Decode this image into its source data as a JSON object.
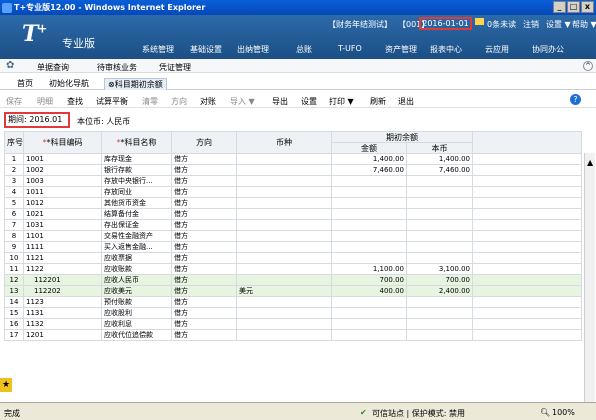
{
  "window": {
    "title": "T+专业版12.00 - Windows Internet Explorer",
    "min": "_",
    "max": "□",
    "close": "x"
  },
  "banner": {
    "logo": "T",
    "logo_plus": "+",
    "edition": "专业版",
    "company": "【财务年结测试】",
    "user": "【001】",
    "date": "2016-01-01",
    "messages": "0条未读",
    "logout": "注销",
    "settings": "设置 ▼",
    "help": "帮助 ▼"
  },
  "nav": {
    "items": [
      "系统管理",
      "基础设置",
      "出纳管理",
      "总账",
      "T-UFO",
      "资产管理",
      "报表中心",
      "云应用",
      "协同办公"
    ]
  },
  "subnav": {
    "items": [
      "单据查询",
      "待审核业务",
      "凭证管理"
    ]
  },
  "tabs": {
    "home": "首页",
    "guide": "初始化导航",
    "active": "科目期初余额"
  },
  "toolbar": {
    "items": [
      "保存",
      "明细",
      "查找",
      "试算平衡",
      "清零",
      "方向",
      "对账",
      "导入 ▼",
      "导出",
      "设置",
      "打印 ▼",
      "刷新",
      "退出"
    ],
    "help": "?"
  },
  "info": {
    "period_label": "期间:",
    "period": "2016.01",
    "currency": "本位币: 人民币"
  },
  "table": {
    "headers": {
      "seq": "序号",
      "code": "*科目编码",
      "name": "*科目名称",
      "direction": "方向",
      "currency": "币种",
      "opening": "期初余额",
      "amount": "金额",
      "base": "本币"
    },
    "rows": [
      {
        "n": "1",
        "code": "1001",
        "name": "库存现金",
        "dir": "借方",
        "cur": "",
        "amount": "1,400.00",
        "base": "1,400.00"
      },
      {
        "n": "2",
        "code": "1002",
        "name": "银行存款",
        "dir": "借方",
        "cur": "",
        "amount": "7,460.00",
        "base": "7,460.00"
      },
      {
        "n": "3",
        "code": "1003",
        "name": "存放中央银行...",
        "dir": "借方",
        "cur": "",
        "amount": "",
        "base": ""
      },
      {
        "n": "4",
        "code": "1011",
        "name": "存放同业",
        "dir": "借方",
        "cur": "",
        "amount": "",
        "base": ""
      },
      {
        "n": "5",
        "code": "1012",
        "name": "其他货币资金",
        "dir": "借方",
        "cur": "",
        "amount": "",
        "base": ""
      },
      {
        "n": "6",
        "code": "1021",
        "name": "结算备付金",
        "dir": "借方",
        "cur": "",
        "amount": "",
        "base": ""
      },
      {
        "n": "7",
        "code": "1031",
        "name": "存出保证金",
        "dir": "借方",
        "cur": "",
        "amount": "",
        "base": ""
      },
      {
        "n": "8",
        "code": "1101",
        "name": "交易性金融资产",
        "dir": "借方",
        "cur": "",
        "amount": "",
        "base": ""
      },
      {
        "n": "9",
        "code": "1111",
        "name": "买入返售金融...",
        "dir": "借方",
        "cur": "",
        "amount": "",
        "base": ""
      },
      {
        "n": "10",
        "code": "1121",
        "name": "应收票据",
        "dir": "借方",
        "cur": "",
        "amount": "",
        "base": ""
      },
      {
        "n": "11",
        "code": "1122",
        "name": "应收账款",
        "dir": "借方",
        "cur": "",
        "amount": "1,100.00",
        "base": "3,100.00"
      },
      {
        "n": "12",
        "code": "112201",
        "name": "应收人民币",
        "dir": "借方",
        "cur": "",
        "amount": "700.00",
        "base": "700.00"
      },
      {
        "n": "13",
        "code": "112202",
        "name": "应收美元",
        "dir": "借方",
        "cur": "美元",
        "amount": "400.00",
        "base": "2,400.00"
      },
      {
        "n": "14",
        "code": "1123",
        "name": "预付账款",
        "dir": "借方",
        "cur": "",
        "amount": "",
        "base": ""
      },
      {
        "n": "15",
        "code": "1131",
        "name": "应收股利",
        "dir": "借方",
        "cur": "",
        "amount": "",
        "base": ""
      },
      {
        "n": "16",
        "code": "1132",
        "name": "应收利息",
        "dir": "借方",
        "cur": "",
        "amount": "",
        "base": ""
      },
      {
        "n": "17",
        "code": "1201",
        "name": "应收代位追偿款",
        "dir": "借方",
        "cur": "",
        "amount": "",
        "base": ""
      }
    ]
  },
  "status": {
    "done": "完成",
    "zone": "可信站点 | 保护模式: 禁用",
    "zoom": "100%"
  }
}
